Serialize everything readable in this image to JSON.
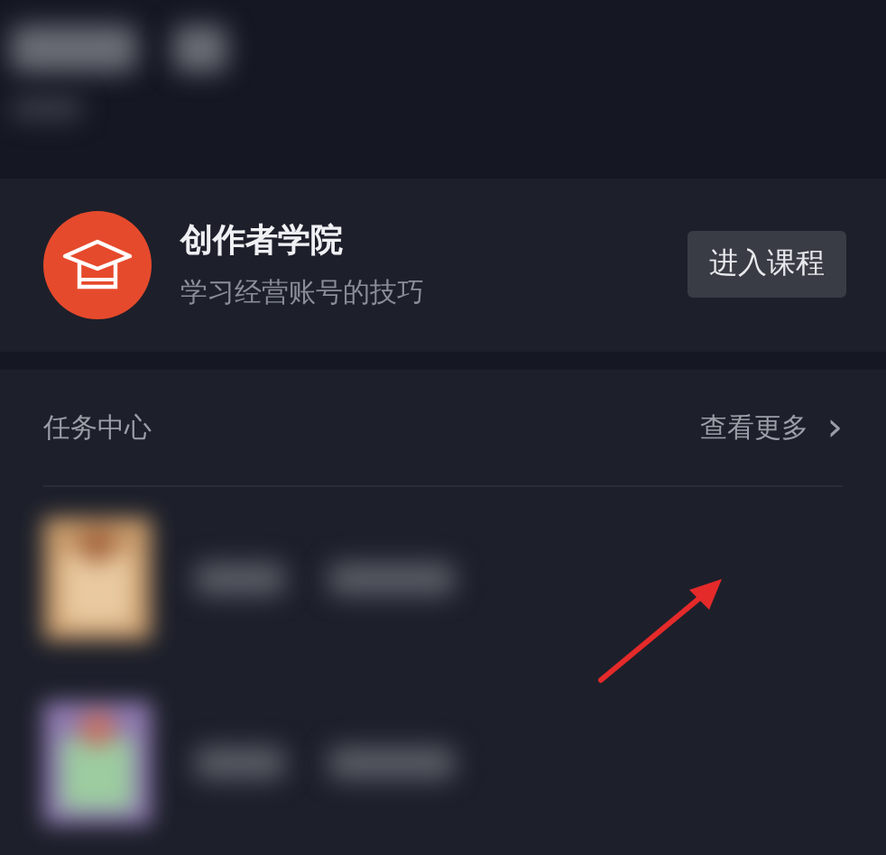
{
  "academy": {
    "title": "创作者学院",
    "subtitle": "学习经营账号的技巧",
    "button": "进入课程"
  },
  "task_center": {
    "title": "任务中心",
    "more_link": "查看更多",
    "more_chevron": "›",
    "tasks": [
      {
        "kind": "redacted",
        "color": "#c79a6a"
      },
      {
        "kind": "redacted",
        "color": "#8f7ab0"
      }
    ]
  },
  "annotation": {
    "kind": "arrow"
  }
}
